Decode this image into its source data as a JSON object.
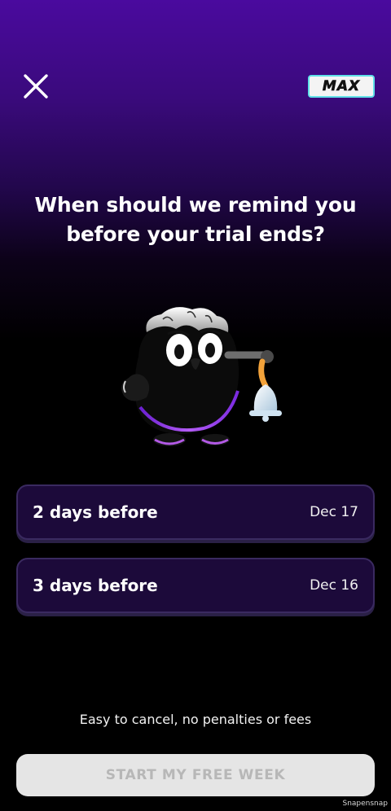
{
  "header": {
    "close_icon": "close-icon",
    "badge_label": "MAX",
    "badge_colors": {
      "border": "#5fe0e8",
      "fill": "#f4f4f4"
    }
  },
  "headline": {
    "line1": "When should we remind you",
    "line2": "before your trial ends?"
  },
  "illustration": {
    "icon": "mascot-holding-bell-icon"
  },
  "options": [
    {
      "label": "2 days before",
      "date": "Dec 17"
    },
    {
      "label": "3 days before",
      "date": "Dec 16"
    }
  ],
  "footer": {
    "fine_print": "Easy to cancel, no penalties or fees",
    "cta_label": "START MY FREE WEEK",
    "watermark": "Snapensnap"
  },
  "colors": {
    "background_top": "#4a0a9e",
    "background_bottom": "#000000",
    "option_fill": "#1c0a3a",
    "cta_fill": "#e5e5e5",
    "cta_text": "#b7b7b7"
  }
}
